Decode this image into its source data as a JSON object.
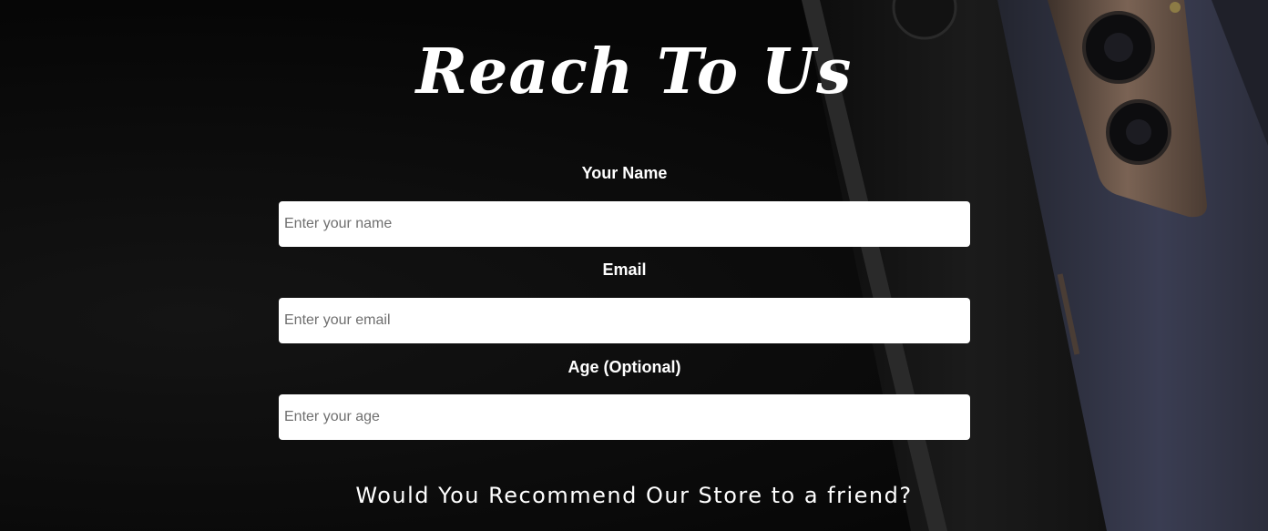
{
  "form": {
    "title": "Reach To Us",
    "fields": [
      {
        "label": "Your Name",
        "placeholder": "Enter your name",
        "value": ""
      },
      {
        "label": "Email",
        "placeholder": "Enter your email",
        "value": ""
      },
      {
        "label": "Age (Optional)",
        "placeholder": "Enter your age",
        "value": ""
      }
    ],
    "question": "Would You Recommend Our Store to a friend?"
  },
  "colors": {
    "background": "#0a0a0a",
    "text": "#ffffff",
    "input_bg": "#ffffff",
    "phone_body": "#1a1a1d",
    "phone_frame": "#6b5548",
    "phone_accent": "#3a3d52"
  }
}
